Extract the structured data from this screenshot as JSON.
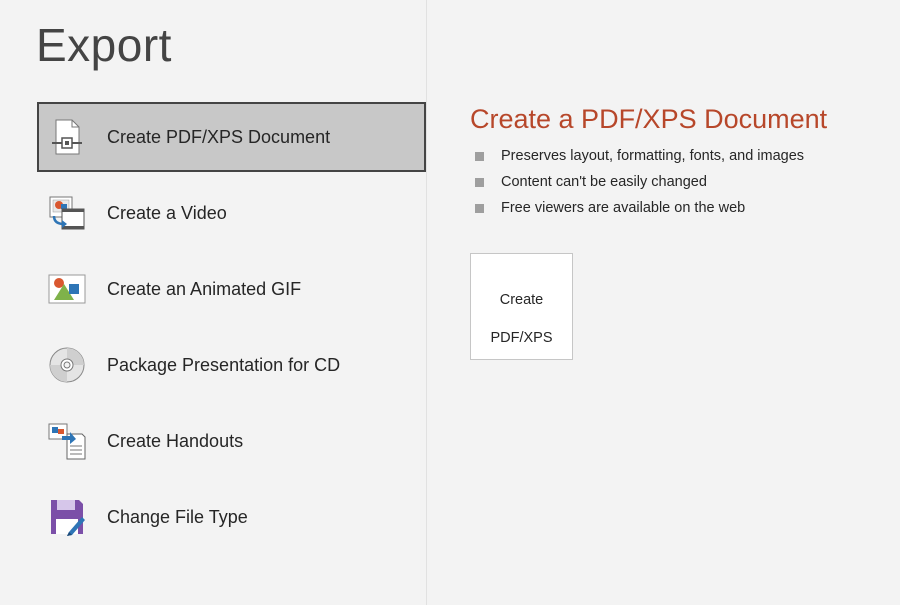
{
  "page": {
    "title": "Export"
  },
  "options": [
    {
      "label": "Create PDF/XPS Document",
      "icon": "pdf-document-icon",
      "selected": true
    },
    {
      "label": "Create a Video",
      "icon": "video-icon",
      "selected": false
    },
    {
      "label": "Create an Animated GIF",
      "icon": "animated-gif-icon",
      "selected": false
    },
    {
      "label": "Package Presentation for CD",
      "icon": "cd-icon",
      "selected": false
    },
    {
      "label": "Create Handouts",
      "icon": "handouts-icon",
      "selected": false
    },
    {
      "label": "Change File Type",
      "icon": "save-disk-icon",
      "selected": false
    }
  ],
  "detail": {
    "title": "Create a PDF/XPS Document",
    "bullets": [
      "Preserves layout, formatting, fonts, and images",
      "Content can't be easily changed",
      "Free viewers are available on the web"
    ],
    "action_button": {
      "label_line1": "Create",
      "label_line2": "PDF/XPS",
      "icon": "pdf-document-icon"
    }
  },
  "colors": {
    "accent": "#b7472a",
    "selected_bg": "#c8c8c8",
    "pane_bg": "#f3f3f3",
    "purple": "#7b4fa8"
  }
}
